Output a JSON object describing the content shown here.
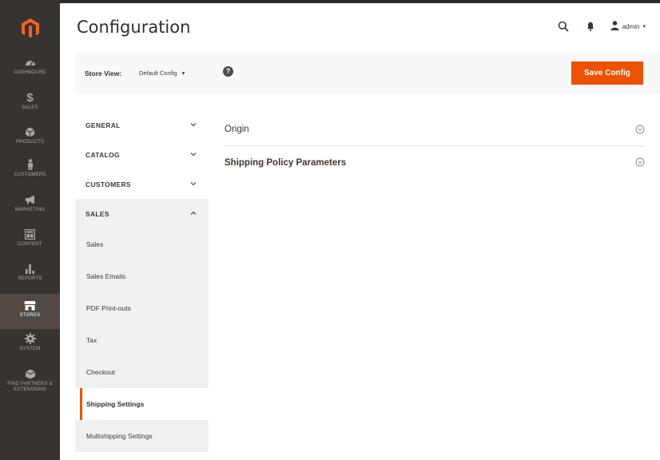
{
  "page": {
    "title": "Configuration"
  },
  "admin_nav": {
    "items": [
      {
        "label": "DASHBOARD",
        "icon": "dashboard-icon"
      },
      {
        "label": "SALES",
        "icon": "dollar-icon"
      },
      {
        "label": "PRODUCTS",
        "icon": "cube-icon"
      },
      {
        "label": "CUSTOMERS",
        "icon": "person-icon"
      },
      {
        "label": "MARKETING",
        "icon": "megaphone-icon"
      },
      {
        "label": "CONTENT",
        "icon": "layout-icon"
      },
      {
        "label": "REPORTS",
        "icon": "bar-chart-icon"
      },
      {
        "label": "STORES",
        "icon": "store-icon",
        "active": true
      },
      {
        "label": "SYSTEM",
        "icon": "gear-icon"
      },
      {
        "label": "FIND PARTNERS & EXTENSIONS",
        "icon": "partners-icon"
      }
    ]
  },
  "header": {
    "user": "admin"
  },
  "store_bar": {
    "label": "Store View:",
    "value": "Default Config",
    "help": "?",
    "save_label": "Save Config"
  },
  "tabs": {
    "general": "GENERAL",
    "catalog": "CATALOG",
    "customers": "CUSTOMERS",
    "sales": "SALES",
    "sales_items": [
      "Sales",
      "Sales Emails",
      "PDF Print-outs",
      "Tax",
      "Checkout",
      "Shipping Settings",
      "Multishipping Settings"
    ],
    "active_item": "Shipping Settings"
  },
  "sections": [
    {
      "title": "Origin"
    },
    {
      "title": "Shipping Policy Parameters"
    }
  ],
  "colors": {
    "accent": "#eb5202",
    "nav_bg": "#373330",
    "nav_active": "#514943",
    "bar_bg": "#f8f8f8"
  }
}
